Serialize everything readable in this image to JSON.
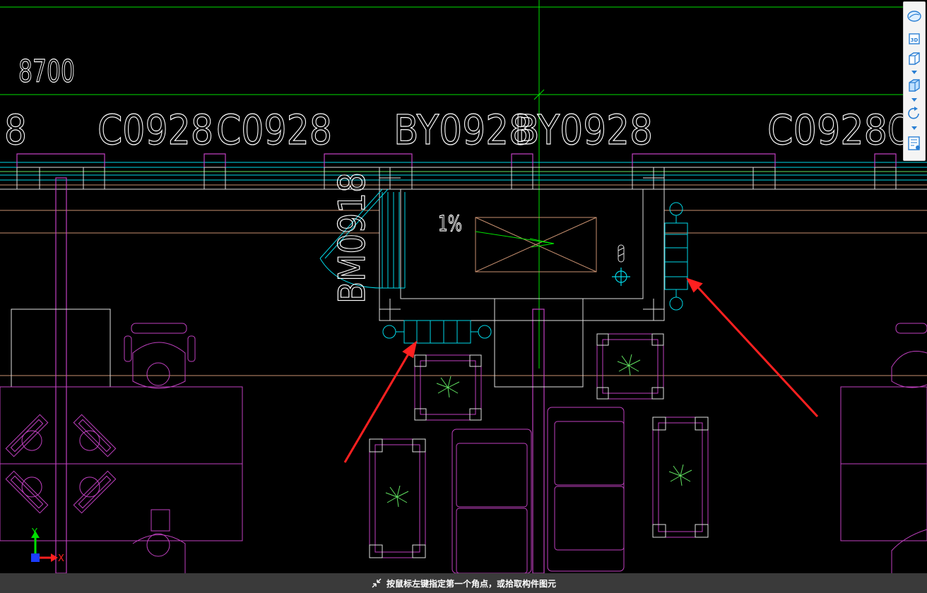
{
  "drawing": {
    "dimension_text": "8700",
    "window_labels": [
      "8",
      "C0928",
      "C0928",
      "BY0928",
      "BY0928",
      "C0928",
      "C"
    ],
    "door_label": "BM0918",
    "slope_label": "1%"
  },
  "axis_indicator": {
    "y_label": "Y",
    "x_label": "X"
  },
  "toolbar": {
    "items": [
      "cloud-view-icon",
      "3d-view-icon",
      "box-view-icon",
      "shaded-box-icon",
      "rotate-view-icon",
      "layer-properties-icon"
    ]
  },
  "status_bar": {
    "prompt": "按鼠标左键指定第一个角点，或拾取构件图元"
  },
  "colors": {
    "background": "#000000",
    "green_axis": "#00e000",
    "cyan": "#00d8e8",
    "magenta": "#c040c0",
    "wall_white": "#e0e0e0",
    "beam_tan": "#c89070",
    "plant_green": "#60e060",
    "annotation_red": "#ff2020",
    "statusbar": "#3a3a3a"
  }
}
